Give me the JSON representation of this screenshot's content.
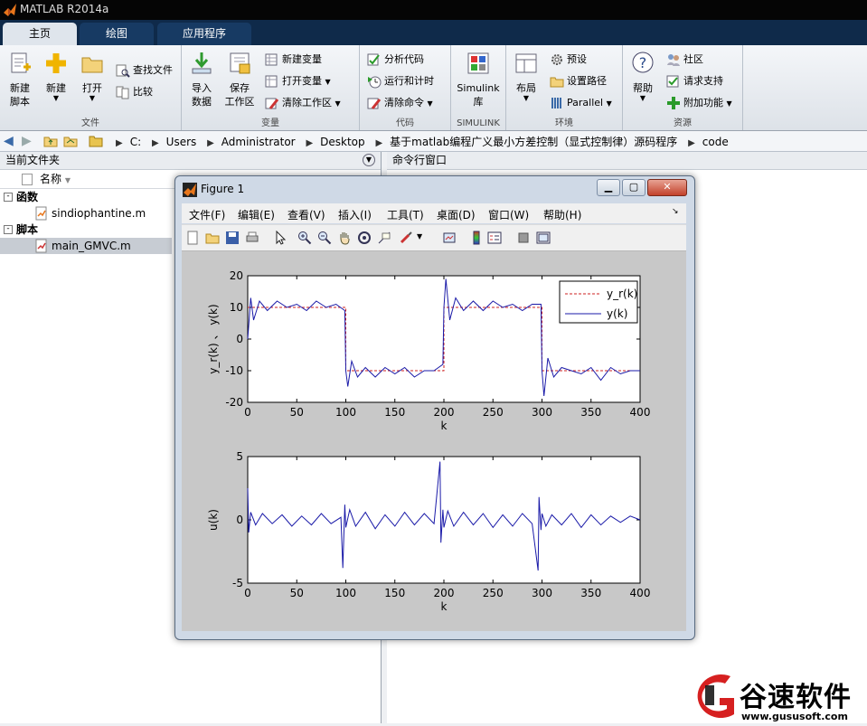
{
  "app": {
    "title": "MATLAB R2014a"
  },
  "tabs": [
    {
      "label": "主页"
    },
    {
      "label": "绘图"
    },
    {
      "label": "应用程序"
    }
  ],
  "ribbon": {
    "file": {
      "group_label": "文件",
      "new_script": "新建\n脚本",
      "new": "新建",
      "open": "打开",
      "find_files": "查找文件",
      "compare": "比较"
    },
    "variable": {
      "group_label": "变量",
      "import": "导入\n数据",
      "save_ws": "保存\n工作区",
      "new_var": "新建变量",
      "open_var": "打开变量",
      "clear_ws": "清除工作区"
    },
    "code": {
      "group_label": "代码",
      "analyze": "分析代码",
      "run_time": "运行和计时",
      "clear_cmd": "清除命令"
    },
    "simulink": {
      "group_label": "SIMULINK",
      "lib": "Simulink\n库"
    },
    "env": {
      "group_label": "环境",
      "layout": "布局",
      "prefs": "预设",
      "set_path": "设置路径",
      "parallel": "Parallel"
    },
    "resources": {
      "group_label": "资源",
      "help": "帮助",
      "community": "社区",
      "support": "请求支持",
      "addons": "附加功能"
    }
  },
  "address": {
    "crumbs": [
      "C:",
      "Users",
      "Administrator",
      "Desktop",
      "基于matlab编程广义最小方差控制（显式控制律）源码程序",
      "code"
    ]
  },
  "left_panel": {
    "title": "当前文件夹",
    "column": "名称",
    "sections": [
      {
        "label": "函数",
        "files": [
          "sindiophantine.m"
        ]
      },
      {
        "label": "脚本",
        "files": [
          "main_GMVC.m"
        ]
      }
    ]
  },
  "right_panel": {
    "title": "命令行窗口"
  },
  "figure": {
    "title": "Figure 1",
    "menu": [
      "文件(F)",
      "编辑(E)",
      "查看(V)",
      "插入(I)",
      "工具(T)",
      "桌面(D)",
      "窗口(W)",
      "帮助(H)"
    ]
  },
  "watermark": {
    "text": "谷速软件",
    "url": "www.gususoft.com"
  },
  "chart_data": [
    {
      "type": "line",
      "xlabel": "k",
      "ylabel": "y_r(k) 、 y(k)",
      "xlim": [
        0,
        400
      ],
      "ylim": [
        -20,
        20
      ],
      "xticks": [
        "0",
        "50",
        "100",
        "150",
        "200",
        "250",
        "300",
        "350",
        "400"
      ],
      "yticks": [
        "20",
        "10",
        "0",
        "-10",
        "-20"
      ],
      "legend": {
        "placement": "top-right",
        "entries": [
          "y_r(k)",
          "y(k)"
        ]
      },
      "series": [
        {
          "name": "y_r(k)",
          "color": "#cc2020",
          "style": "dashed",
          "x": [
            0,
            100,
            100,
            200,
            200,
            300,
            300,
            400
          ],
          "y": [
            10,
            10,
            -10,
            -10,
            10,
            10,
            -10,
            -10
          ]
        },
        {
          "name": "y(k)",
          "color": "#1a1aa8",
          "style": "solid",
          "x": [
            0,
            3,
            6,
            12,
            20,
            30,
            40,
            50,
            60,
            70,
            80,
            90,
            99,
            100,
            102,
            106,
            112,
            120,
            130,
            140,
            150,
            160,
            170,
            180,
            190,
            199,
            200,
            202,
            206,
            212,
            220,
            230,
            240,
            250,
            260,
            270,
            280,
            290,
            299,
            300,
            302,
            306,
            312,
            320,
            330,
            340,
            350,
            360,
            370,
            380,
            390,
            400
          ],
          "y": [
            0,
            13,
            6,
            12,
            9,
            12,
            10,
            11,
            9,
            12,
            10,
            11,
            9,
            -10,
            -15,
            -7,
            -12,
            -9,
            -12,
            -9,
            -11,
            -9,
            -12,
            -10,
            -10,
            -8,
            10,
            19,
            6,
            13,
            9,
            12,
            9,
            12,
            10,
            11,
            9,
            11,
            11,
            -10,
            -18,
            -6,
            -12,
            -9,
            -10,
            -11,
            -9,
            -13,
            -9,
            -11,
            -10,
            -10
          ]
        }
      ]
    },
    {
      "type": "line",
      "xlabel": "k",
      "ylabel": "u(k)",
      "xlim": [
        0,
        400
      ],
      "ylim": [
        -5,
        5
      ],
      "xticks": [
        "0",
        "50",
        "100",
        "150",
        "200",
        "250",
        "300",
        "350",
        "400"
      ],
      "yticks": [
        "5",
        "0",
        "-5"
      ],
      "series": [
        {
          "color": "#1a1aa8",
          "style": "solid",
          "x": [
            0,
            1,
            3,
            8,
            15,
            25,
            35,
            45,
            55,
            65,
            75,
            85,
            95,
            97,
            99,
            100,
            104,
            110,
            120,
            130,
            140,
            150,
            160,
            170,
            180,
            190,
            196,
            197,
            199,
            200,
            204,
            210,
            220,
            230,
            240,
            250,
            260,
            270,
            280,
            290,
            296,
            297,
            299,
            300,
            304,
            310,
            320,
            330,
            340,
            350,
            360,
            370,
            380,
            390,
            400
          ],
          "y": [
            2.5,
            -1,
            0.6,
            -0.4,
            0.5,
            -0.3,
            0.4,
            -0.5,
            0.3,
            -0.4,
            0.5,
            -0.3,
            0.2,
            -3.8,
            1.2,
            -0.6,
            0.8,
            -0.5,
            0.6,
            -0.7,
            0.4,
            -0.5,
            0.6,
            -0.4,
            0.5,
            -0.3,
            4.6,
            -1.8,
            0.8,
            -0.6,
            0.7,
            -0.5,
            0.6,
            -0.4,
            0.5,
            -0.6,
            0.4,
            -0.5,
            0.5,
            -0.3,
            -4.0,
            1.8,
            -0.8,
            0.5,
            -0.5,
            0.4,
            -0.4,
            0.5,
            -0.6,
            0.4,
            -0.4,
            0.3,
            -0.2,
            0.3,
            0
          ]
        }
      ]
    }
  ]
}
